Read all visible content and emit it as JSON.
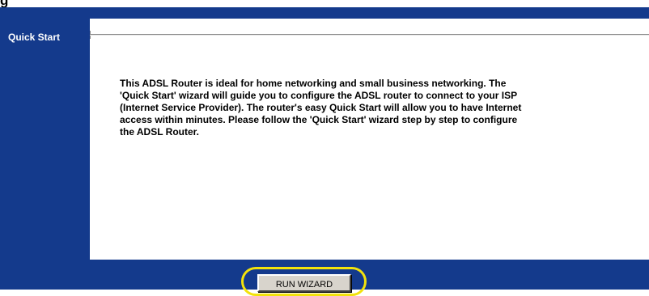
{
  "sidebar": {
    "section_title": "Quick Start"
  },
  "main": {
    "description": "This ADSL Router is ideal for home networking and small business networking. The\n'Quick Start' wizard will guide you to configure the ADSL router to connect to your ISP\n(Internet Service Provider). The router's easy Quick Start will allow you to have Internet\naccess within minutes. Please follow the 'Quick Start' wizard step by step to configure\nthe ADSL Router."
  },
  "actions": {
    "run_wizard_label": "RUN WIZARD"
  },
  "colors": {
    "frame_blue": "#143a8c",
    "highlight_yellow": "#f2e20c",
    "button_face": "#d8d4cc"
  }
}
